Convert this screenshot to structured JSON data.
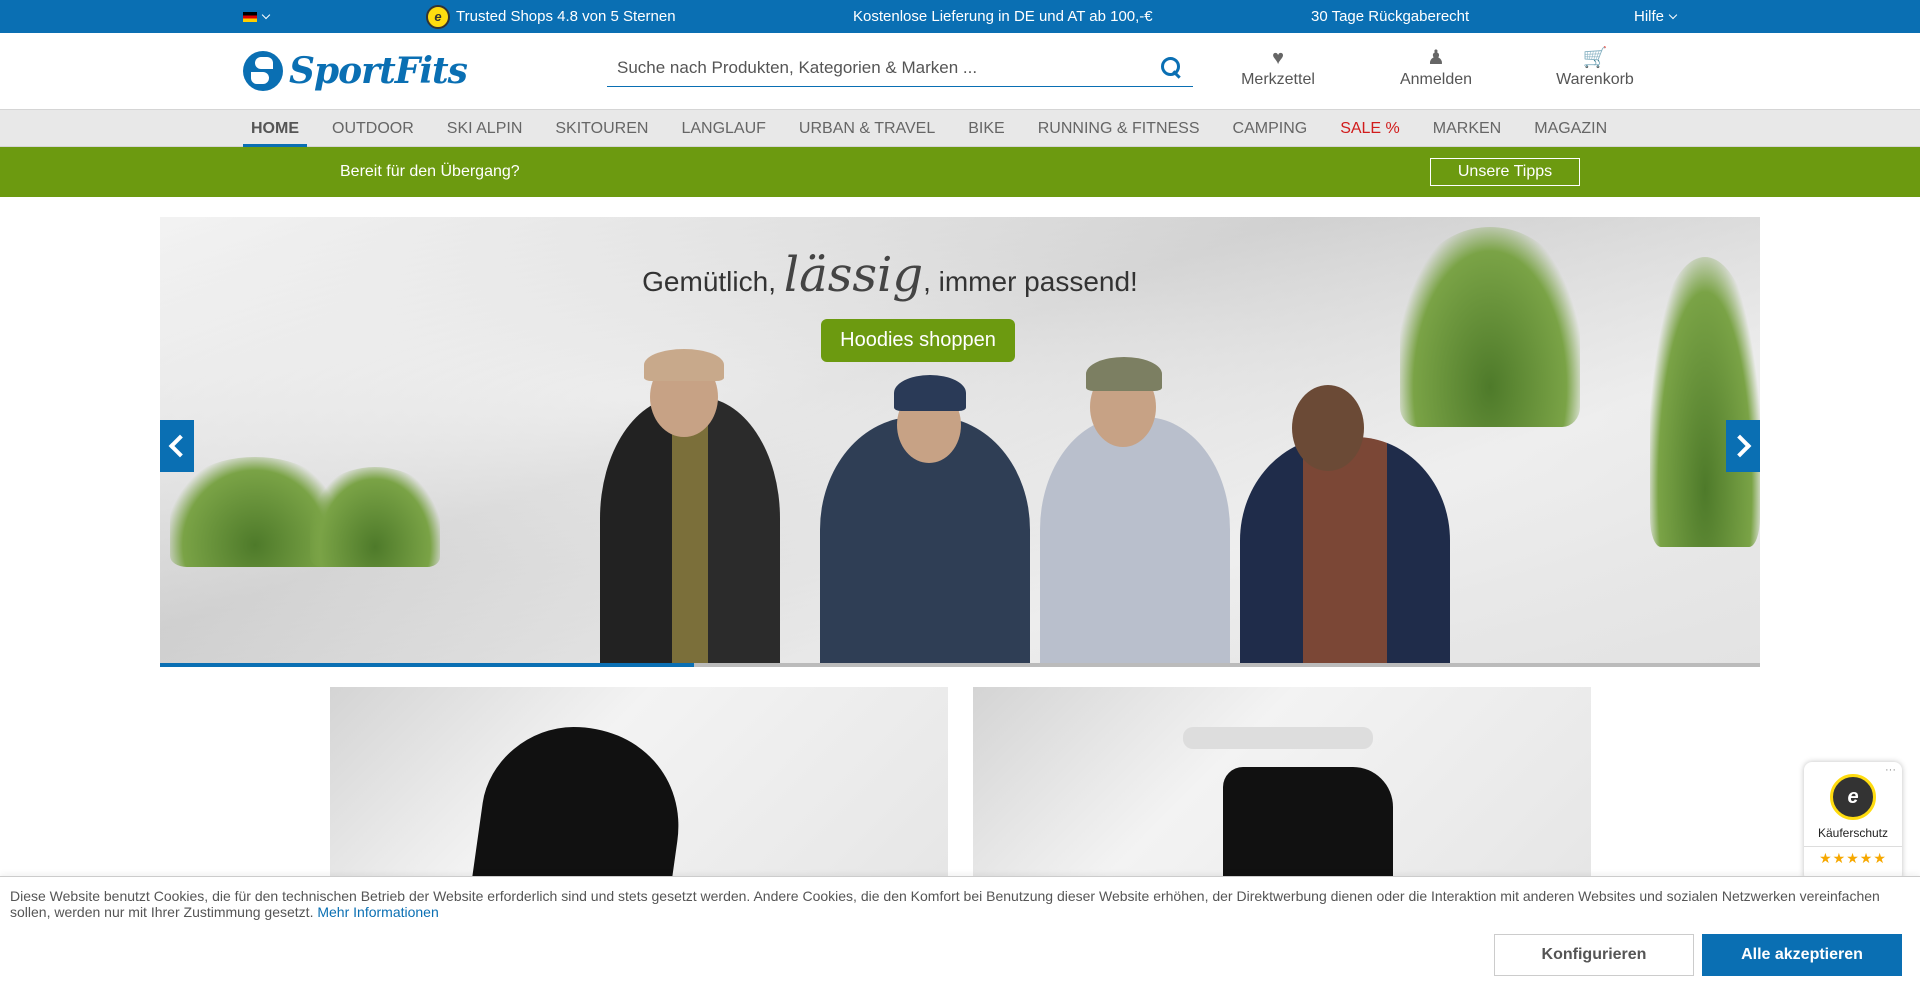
{
  "topbar": {
    "language_flag": "de-flag-icon",
    "trusted_shops": "Trusted Shops 4.8 von 5 Sternen",
    "shipping": "Kostenlose Lieferung in DE und AT ab 100,-€",
    "returns": "30 Tage Rückgaberecht",
    "help": "Hilfe",
    "badge_letter": "e"
  },
  "header": {
    "logo_text": "SportFits",
    "search_placeholder": "Suche nach Produkten, Kategorien & Marken ...",
    "wishlist": "Merkzettel",
    "login": "Anmelden",
    "cart": "Warenkorb"
  },
  "nav": {
    "items": [
      "HOME",
      "OUTDOOR",
      "SKI ALPIN",
      "SKITOUREN",
      "LANGLAUF",
      "URBAN & TRAVEL",
      "BIKE",
      "RUNNING & FITNESS",
      "CAMPING",
      "SALE %",
      "MARKEN",
      "MAGAZIN"
    ],
    "active_index": 0,
    "sale_index": 9
  },
  "promo": {
    "text": "Bereit für den Übergang?",
    "button": "Unsere Tipps"
  },
  "hero": {
    "headline_before": "Gemütlich,",
    "headline_script": "lässig",
    "headline_after": ", immer passend!",
    "cta": "Hoodies shoppen",
    "progress": 0.334
  },
  "trusted_widget": {
    "label": "Käuferschutz",
    "stars": "★★★★★",
    "seal_letter": "e",
    "menu": "···"
  },
  "cookie": {
    "text": "Diese Website benutzt Cookies, die für den technischen Betrieb der Website erforderlich sind und stets gesetzt werden. Andere Cookies, die den Komfort bei Benutzung dieser Website erhöhen, der Direktwerbung dienen oder die Interaktion mit anderen Websites und sozialen Netzwerken vereinfachen sollen, werden nur mit Ihrer Zustimmung gesetzt.",
    "more_info": "Mehr Informationen",
    "configure": "Konfigurieren",
    "accept_all": "Alle akzeptieren"
  },
  "colors": {
    "brand_blue": "#0a6fb3",
    "promo_green": "#6c9a10",
    "sale_red": "#d11b1b"
  }
}
